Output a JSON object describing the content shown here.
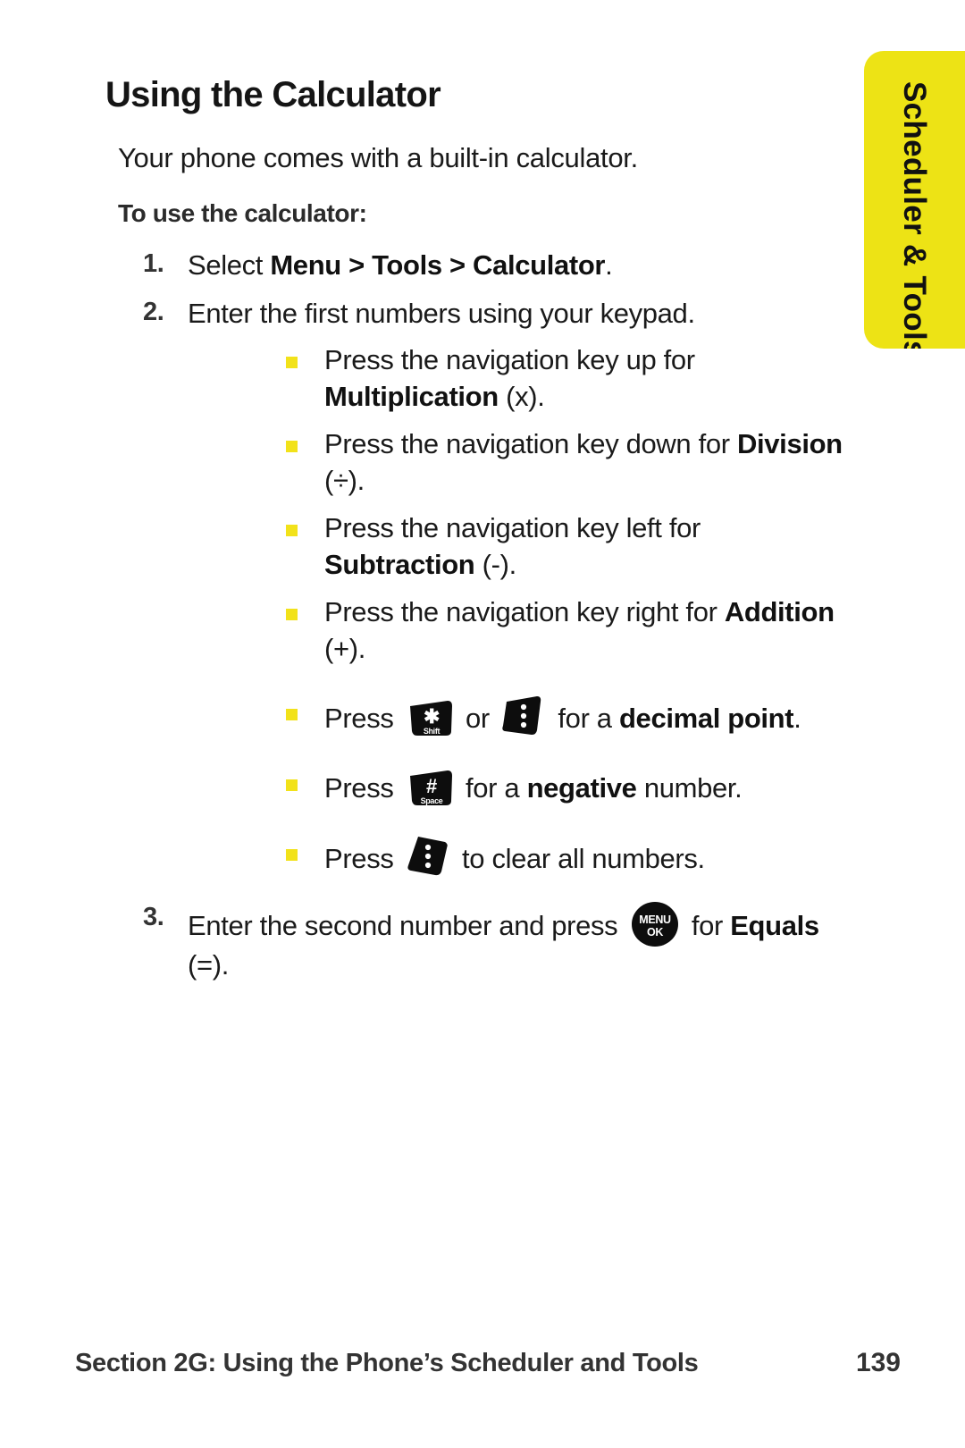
{
  "side_tab": {
    "label": "Scheduler & Tools",
    "background_color": "#EDE315",
    "text_color": "#111111"
  },
  "heading": "Using the Calculator",
  "intro": "Your phone comes with a built-in calculator.",
  "subheading": "To use the calculator:",
  "bullet_color": "#F2E21A",
  "steps": [
    {
      "number": "1.",
      "parts": [
        {
          "type": "text",
          "value": "Select "
        },
        {
          "type": "bold",
          "value": "Menu > Tools > Calculator"
        },
        {
          "type": "text",
          "value": "."
        }
      ]
    },
    {
      "number": "2.",
      "parts": [
        {
          "type": "text",
          "value": "Enter the first numbers using your keypad."
        }
      ],
      "bullets": [
        {
          "parts": [
            {
              "type": "text",
              "value": "Press the navigation key up for "
            },
            {
              "type": "bold",
              "value": "Multiplication"
            },
            {
              "type": "text",
              "value": " (x)."
            }
          ]
        },
        {
          "parts": [
            {
              "type": "text",
              "value": "Press the navigation key down for "
            },
            {
              "type": "bold",
              "value": "Division"
            },
            {
              "type": "text",
              "value": " (÷)."
            }
          ]
        },
        {
          "parts": [
            {
              "type": "text",
              "value": "Press the navigation key left for "
            },
            {
              "type": "bold",
              "value": "Subtraction"
            },
            {
              "type": "text",
              "value": " (-)."
            }
          ]
        },
        {
          "parts": [
            {
              "type": "text",
              "value": "Press the navigation key right for "
            },
            {
              "type": "bold",
              "value": "Addition"
            },
            {
              "type": "text",
              "value": " (+)."
            }
          ]
        },
        {
          "spaced": true,
          "parts": [
            {
              "type": "text",
              "value": "Press "
            },
            {
              "type": "key",
              "value": "star-shift-key"
            },
            {
              "type": "text",
              "value": " or "
            },
            {
              "type": "key",
              "value": "right-soft-key"
            },
            {
              "type": "text",
              "value": " for a "
            },
            {
              "type": "bold",
              "value": "decimal point"
            },
            {
              "type": "text",
              "value": "."
            }
          ]
        },
        {
          "spaced": true,
          "parts": [
            {
              "type": "text",
              "value": "Press "
            },
            {
              "type": "key",
              "value": "pound-space-key"
            },
            {
              "type": "text",
              "value": " for a "
            },
            {
              "type": "bold",
              "value": "negative"
            },
            {
              "type": "text",
              "value": " number."
            }
          ]
        },
        {
          "spaced": true,
          "parts": [
            {
              "type": "text",
              "value": "Press "
            },
            {
              "type": "key",
              "value": "left-soft-key"
            },
            {
              "type": "text",
              "value": " to clear all numbers."
            }
          ]
        }
      ]
    },
    {
      "number": "3.",
      "spaced": true,
      "parts": [
        {
          "type": "text",
          "value": "Enter the second number and press "
        },
        {
          "type": "key",
          "value": "menu-ok-key"
        },
        {
          "type": "text",
          "value": " for "
        },
        {
          "type": "bold",
          "value": "Equals"
        },
        {
          "type": "text",
          "value": " (=)."
        }
      ]
    }
  ],
  "keys": {
    "star-shift-key": {
      "glyph": "✱",
      "label": "Shift"
    },
    "pound-space-key": {
      "glyph": "#",
      "label": "Space"
    },
    "left-soft-key": {
      "glyph": "dots"
    },
    "right-soft-key": {
      "glyph": "dots"
    },
    "menu-ok-key": {
      "line1": "MENU",
      "line2": "OK"
    }
  },
  "footer": {
    "section_text": "Section 2G: Using the Phone’s Scheduler and Tools",
    "page_number": "139"
  }
}
